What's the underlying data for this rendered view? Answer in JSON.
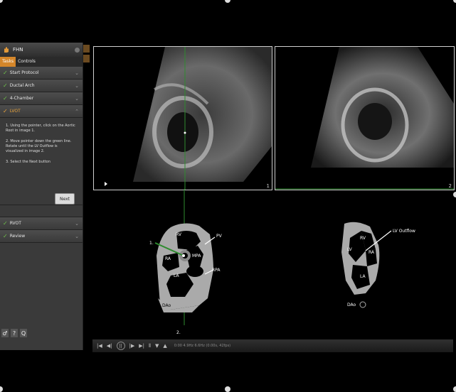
{
  "panel": {
    "title": "FHN",
    "tabs": [
      "Tasks",
      "Controls"
    ],
    "items": [
      {
        "label": "Start Protocol",
        "done": true
      },
      {
        "label": "Ductal Arch",
        "done": true
      },
      {
        "label": "4-Chamber",
        "done": true
      },
      {
        "label": "LVOT",
        "done": false
      }
    ],
    "instructions": [
      "1. Using the pointer, click on the Aortic Root in image 1.",
      "2. Move pointer down the green line. Rotate until the LV Outflow is visualized in image 2.",
      "3. Select the Next button"
    ],
    "next_label": "Next",
    "later_items": [
      {
        "label": "RVOT"
      },
      {
        "label": "Review"
      }
    ]
  },
  "images": {
    "image1_num": "1",
    "image2_num": "2"
  },
  "diagram_left": {
    "labels": {
      "rv": "RV",
      "pv": "PV",
      "ra": "RA",
      "mpa": "MPA",
      "rpa": "RPA",
      "la": "LA",
      "dao": "DAo",
      "marker1": "1.",
      "marker2": "2."
    }
  },
  "diagram_right": {
    "labels": {
      "rv": "RV",
      "lv": "LV",
      "ra": "RA",
      "la": "LA",
      "dao": "DAo",
      "lv_outflow": "LV Outflow"
    }
  },
  "controls": {
    "buttons": [
      "|◀",
      "◀|",
      "||",
      "|▶",
      "▶|",
      "⫴",
      "▼",
      "▲"
    ],
    "info": "0:00 4.9Hz 6.6Hz (0.00s, 42fps)"
  },
  "colors": {
    "accent": "#d4862a",
    "check": "#6fc24a",
    "guide": "#2e8b2e"
  }
}
